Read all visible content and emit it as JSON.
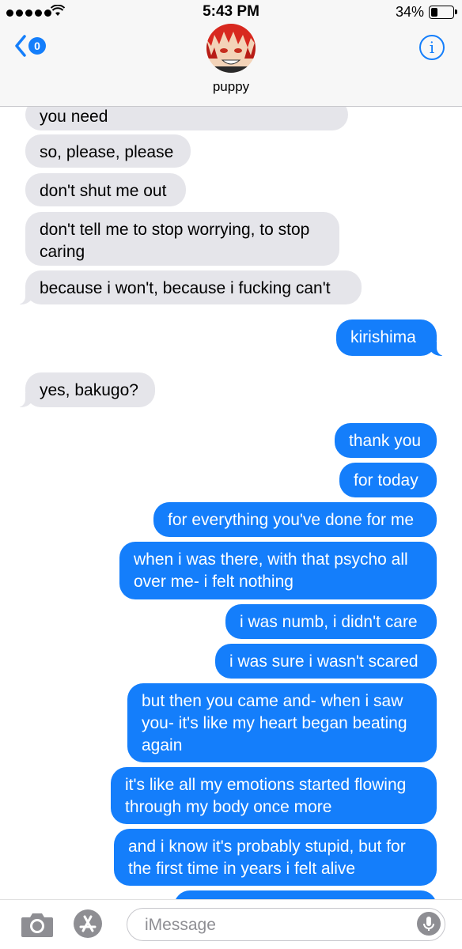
{
  "status_bar": {
    "time": "5:43 PM",
    "battery_percent": "34%",
    "battery_level": 0.34,
    "signal_bars": 5
  },
  "header": {
    "unread_count": "0",
    "contact_name": "puppy",
    "info_label": "i"
  },
  "messages": [
    {
      "text": "you need",
      "side": "in"
    },
    {
      "text": "so, please, please",
      "side": "in"
    },
    {
      "text": "don't shut me out",
      "side": "in"
    },
    {
      "text": "don't tell me to stop worrying, to stop\ncaring",
      "side": "in"
    },
    {
      "text": "because i won't, because i fucking can't",
      "side": "in"
    },
    {
      "text": "kirishima",
      "side": "out"
    },
    {
      "text": "yes, bakugo?",
      "side": "in"
    },
    {
      "text": "thank you",
      "side": "out"
    },
    {
      "text": "for today",
      "side": "out"
    },
    {
      "text": "for everything you've done for me",
      "side": "out"
    },
    {
      "text": "when i was there, with that psycho all\nover me- i felt nothing",
      "side": "out"
    },
    {
      "text": "i was numb, i didn't care",
      "side": "out"
    },
    {
      "text": "i was sure i wasn't scared",
      "side": "out"
    },
    {
      "text": "but then you came and- when i saw\nyou- it's like my heart began beating\nagain",
      "side": "out"
    },
    {
      "text": "it's like all my emotions started flowing\nthrough my body once more",
      "side": "out"
    },
    {
      "text": "and i know it's probably stupid, but for\nthe first time in years i felt alive",
      "side": "out"
    }
  ],
  "input": {
    "placeholder": "iMessage"
  },
  "colors": {
    "accent": "#147efb",
    "incoming_bubble": "#e5e5ea"
  },
  "icons": [
    "wifi-icon",
    "back-chevron-icon",
    "info-icon",
    "camera-icon",
    "app-store-icon",
    "microphone-icon"
  ]
}
